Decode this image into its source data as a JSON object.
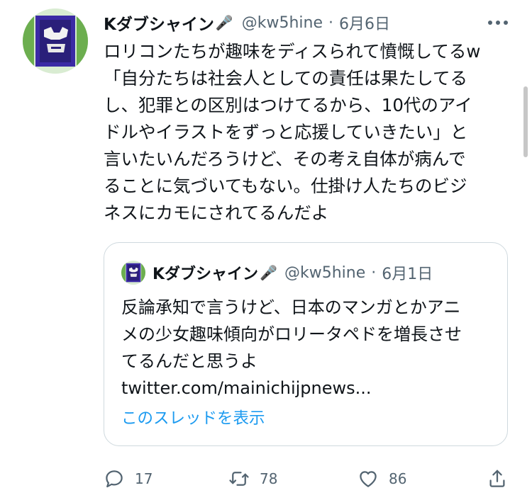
{
  "tweet": {
    "author_name": "Kダブシャイン",
    "name_emoji": "🎤",
    "handle": "@kw5hine",
    "separator": "·",
    "date": "6月6日",
    "lines": [
      "ロリコンたちが趣味をディスられて憤慨してるw",
      "「自分たちは社会人としての責任は果たしてる",
      "し、犯罪との区別はつけてるから、10代のアイ",
      "ドルやイラストをずっと応援していきたい」と",
      "言いたいんだろうけど、その考え自体が病んで",
      "ることに気づいてもない。仕掛け人たちのビジ",
      "ネスにカモにされてるんだよ"
    ]
  },
  "quote": {
    "author_name": "Kダブシャイン",
    "name_emoji": "🎤",
    "handle": "@kw5hine",
    "separator": "·",
    "date": "6月1日",
    "lines": [
      "反論承知で言うけど、日本のマンガとかアニ",
      "メの少女趣味傾向がロリータペドを増長させ",
      "てるんだと思うよ",
      "twitter.com/mainichijpnews..."
    ],
    "show_thread": "このスレッドを表示"
  },
  "actions": {
    "replies": "17",
    "retweets": "78",
    "likes": "86"
  },
  "icons": {
    "more": "more-icon",
    "reply": "reply-icon",
    "retweet": "retweet-icon",
    "like": "heart-icon",
    "share": "share-icon"
  },
  "colors": {
    "link": "#1d9bf0",
    "secondary_text": "#536471",
    "border": "#cfd9de"
  }
}
